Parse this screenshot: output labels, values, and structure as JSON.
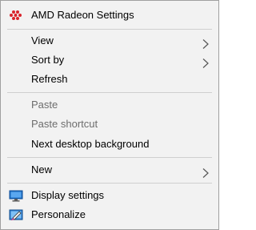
{
  "menu": {
    "amd": {
      "label": "AMD Radeon Settings",
      "icon": "amd-radeon-icon"
    },
    "view": {
      "label": "View"
    },
    "sort_by": {
      "label": "Sort by"
    },
    "refresh": {
      "label": "Refresh"
    },
    "paste": {
      "label": "Paste",
      "disabled": true
    },
    "paste_shortcut": {
      "label": "Paste shortcut",
      "disabled": true
    },
    "next_bg": {
      "label": "Next desktop background"
    },
    "new": {
      "label": "New"
    },
    "display": {
      "label": "Display settings",
      "icon": "display-settings-icon"
    },
    "personalize": {
      "label": "Personalize",
      "icon": "personalize-icon"
    }
  },
  "colors": {
    "menu_bg": "#f2f2f2",
    "disabled_text": "#6d6d6d",
    "amd_red": "#d9242b",
    "accent_blue": "#2a7ad0"
  }
}
